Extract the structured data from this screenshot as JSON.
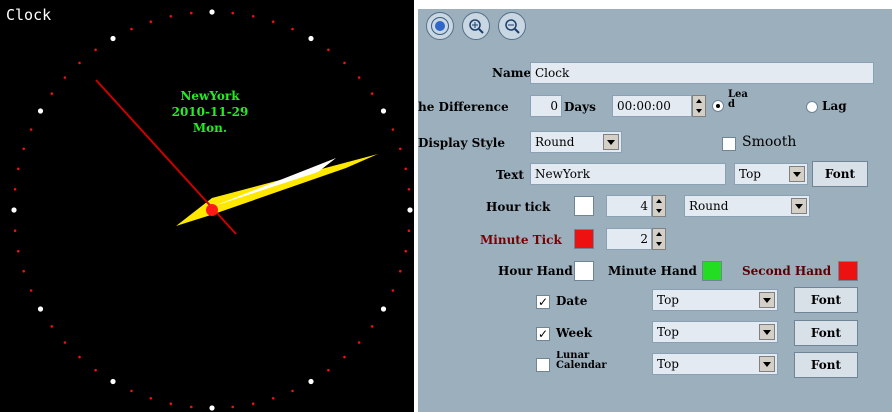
{
  "clock": {
    "title": "Clock",
    "city": "NewYork",
    "date": "2010-11-29",
    "weekday": "Mon."
  },
  "toolbar": {
    "buttons": [
      "record-icon",
      "zoom-in-icon",
      "zoom-out-icon"
    ]
  },
  "settings": {
    "name_label": "Name",
    "name_value": "Clock",
    "time_diff_label": "he Difference",
    "days_value": "0",
    "days_label": "Days",
    "time_value": "00:00:00",
    "lead_label": "Lea\nd",
    "lag_label": "Lag",
    "display_style_label": "Display Style",
    "display_style_value": "Round",
    "smooth_label": "Smooth",
    "text_label": "Text",
    "text_value": "NewYork",
    "text_pos_value": "Top",
    "font_label": "Font",
    "hour_tick_label": "Hour tick",
    "hour_tick_count": "4",
    "hour_tick_shape": "Round",
    "minute_tick_label": "Minute Tick",
    "minute_tick_count": "2",
    "hour_hand_label": "Hour Hand",
    "minute_hand_label": "Minute Hand",
    "second_hand_label": "Second Hand",
    "date_label": "Date",
    "date_pos": "Top",
    "week_label": "Week",
    "week_pos": "Top",
    "lunar_label": "Lunar\nCalendar",
    "lunar_pos": "Top"
  },
  "colors": {
    "hour_tick": "#ffffff",
    "minute_tick": "#ee1111",
    "hour_hand": "#ffffff",
    "minute_hand": "#22dd22",
    "second_hand": "#ee1111",
    "clock_text": "#22ee22"
  }
}
